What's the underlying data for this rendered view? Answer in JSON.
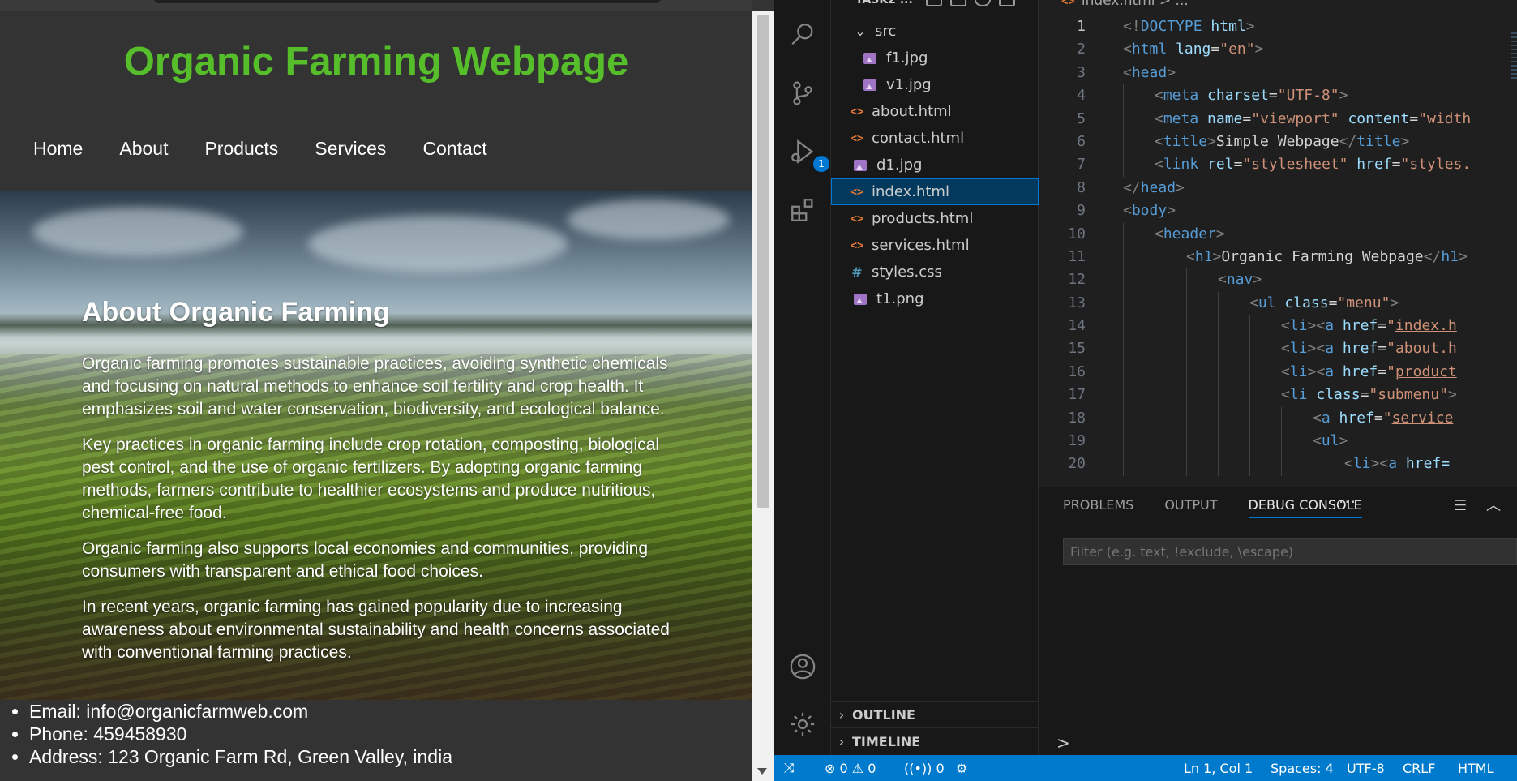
{
  "browser": {
    "site_title": "Organic Farming Webpage",
    "nav": [
      "Home",
      "About",
      "Products",
      "Services",
      "Contact"
    ],
    "about_title": "About Organic Farming",
    "paragraphs": [
      "Organic farming promotes sustainable practices, avoiding synthetic chemicals and focusing on natural methods to enhance soil fertility and crop health. It emphasizes soil and water conservation, biodiversity, and ecological balance.",
      "Key practices in organic farming include crop rotation, composting, biological pest control, and the use of organic fertilizers. By adopting organic farming methods, farmers contribute to healthier ecosystems and produce nutritious, chemical-free food.",
      "Organic farming also supports local economies and communities, providing consumers with transparent and ethical food choices.",
      "In recent years, organic farming has gained popularity due to increasing awareness about environmental sustainability and health concerns associated with conventional farming practices."
    ],
    "footer": {
      "email": "Email: info@organicfarmweb.com",
      "phone": "Phone: 459458930",
      "address": "Address: 123 Organic Farm Rd, Green Valley, india"
    }
  },
  "vscode": {
    "explorer": {
      "folder_title": "TASK2 ...",
      "items": [
        {
          "label": "src",
          "kind": "folder",
          "depth": 0
        },
        {
          "label": "f1.jpg",
          "kind": "image",
          "depth": 1
        },
        {
          "label": "v1.jpg",
          "kind": "image",
          "depth": 1
        },
        {
          "label": "about.html",
          "kind": "html",
          "depth": 0
        },
        {
          "label": "contact.html",
          "kind": "html",
          "depth": 0
        },
        {
          "label": "d1.jpg",
          "kind": "image",
          "depth": 0
        },
        {
          "label": "index.html",
          "kind": "html",
          "depth": 0,
          "selected": true
        },
        {
          "label": "products.html",
          "kind": "html",
          "depth": 0
        },
        {
          "label": "services.html",
          "kind": "html",
          "depth": 0
        },
        {
          "label": "styles.css",
          "kind": "css",
          "depth": 0
        },
        {
          "label": "t1.png",
          "kind": "image",
          "depth": 0
        }
      ],
      "outline_label": "OUTLINE",
      "timeline_label": "TIMELINE"
    },
    "debug_badge": "1",
    "breadcrumb": {
      "file": "index.html",
      "rest": "> ..."
    },
    "code_lines": [
      {
        "n": "1",
        "indent": 0,
        "tokens": [
          [
            "t-tag",
            "<!"
          ],
          [
            "t-name",
            "DOCTYPE"
          ],
          [
            "t-text",
            " "
          ],
          [
            "t-attr",
            "html"
          ],
          [
            "t-tag",
            ">"
          ]
        ]
      },
      {
        "n": "2",
        "indent": 0,
        "tokens": [
          [
            "t-tag",
            "<"
          ],
          [
            "t-name",
            "html"
          ],
          [
            "t-text",
            " "
          ],
          [
            "t-attr",
            "lang"
          ],
          [
            "t-text",
            "="
          ],
          [
            "t-str",
            "\"en\""
          ],
          [
            "t-tag",
            ">"
          ]
        ]
      },
      {
        "n": "3",
        "indent": 0,
        "tokens": [
          [
            "t-tag",
            "<"
          ],
          [
            "t-name",
            "head"
          ],
          [
            "t-tag",
            ">"
          ]
        ]
      },
      {
        "n": "4",
        "indent": 1,
        "tokens": [
          [
            "t-tag",
            "<"
          ],
          [
            "t-name",
            "meta"
          ],
          [
            "t-text",
            " "
          ],
          [
            "t-attr",
            "charset"
          ],
          [
            "t-text",
            "="
          ],
          [
            "t-str",
            "\"UTF-8\""
          ],
          [
            "t-tag",
            ">"
          ]
        ]
      },
      {
        "n": "5",
        "indent": 1,
        "tokens": [
          [
            "t-tag",
            "<"
          ],
          [
            "t-name",
            "meta"
          ],
          [
            "t-text",
            " "
          ],
          [
            "t-attr",
            "name"
          ],
          [
            "t-text",
            "="
          ],
          [
            "t-str",
            "\"viewport\""
          ],
          [
            "t-text",
            " "
          ],
          [
            "t-attr",
            "content"
          ],
          [
            "t-text",
            "="
          ],
          [
            "t-str",
            "\"width"
          ]
        ]
      },
      {
        "n": "6",
        "indent": 1,
        "tokens": [
          [
            "t-tag",
            "<"
          ],
          [
            "t-name",
            "title"
          ],
          [
            "t-tag",
            ">"
          ],
          [
            "t-text",
            "Simple Webpage"
          ],
          [
            "t-tag",
            "</"
          ],
          [
            "t-name",
            "title"
          ],
          [
            "t-tag",
            ">"
          ]
        ]
      },
      {
        "n": "7",
        "indent": 1,
        "tokens": [
          [
            "t-tag",
            "<"
          ],
          [
            "t-name",
            "link"
          ],
          [
            "t-text",
            " "
          ],
          [
            "t-attr",
            "rel"
          ],
          [
            "t-text",
            "="
          ],
          [
            "t-str",
            "\"stylesheet\""
          ],
          [
            "t-text",
            " "
          ],
          [
            "t-attr",
            "href"
          ],
          [
            "t-text",
            "="
          ],
          [
            "t-str",
            "\""
          ],
          [
            "t-link",
            "styles."
          ]
        ]
      },
      {
        "n": "8",
        "indent": 0,
        "tokens": [
          [
            "t-tag",
            "</"
          ],
          [
            "t-name",
            "head"
          ],
          [
            "t-tag",
            ">"
          ]
        ]
      },
      {
        "n": "9",
        "indent": 0,
        "tokens": [
          [
            "t-tag",
            "<"
          ],
          [
            "t-name",
            "body"
          ],
          [
            "t-tag",
            ">"
          ]
        ]
      },
      {
        "n": "10",
        "indent": 1,
        "tokens": [
          [
            "t-tag",
            "<"
          ],
          [
            "t-name",
            "header"
          ],
          [
            "t-tag",
            ">"
          ]
        ]
      },
      {
        "n": "11",
        "indent": 2,
        "tokens": [
          [
            "t-tag",
            "<"
          ],
          [
            "t-name",
            "h1"
          ],
          [
            "t-tag",
            ">"
          ],
          [
            "t-text",
            "Organic Farming Webpage"
          ],
          [
            "t-tag",
            "</"
          ],
          [
            "t-name",
            "h1"
          ],
          [
            "t-tag",
            ">"
          ]
        ]
      },
      {
        "n": "12",
        "indent": 3,
        "tokens": [
          [
            "t-tag",
            "<"
          ],
          [
            "t-name",
            "nav"
          ],
          [
            "t-tag",
            ">"
          ]
        ]
      },
      {
        "n": "13",
        "indent": 4,
        "tokens": [
          [
            "t-tag",
            "<"
          ],
          [
            "t-name",
            "ul"
          ],
          [
            "t-text",
            " "
          ],
          [
            "t-attr",
            "class"
          ],
          [
            "t-text",
            "="
          ],
          [
            "t-str",
            "\"menu\""
          ],
          [
            "t-tag",
            ">"
          ]
        ]
      },
      {
        "n": "14",
        "indent": 5,
        "tokens": [
          [
            "t-tag",
            "<"
          ],
          [
            "t-name",
            "li"
          ],
          [
            "t-tag",
            "><"
          ],
          [
            "t-name",
            "a"
          ],
          [
            "t-text",
            " "
          ],
          [
            "t-attr",
            "href"
          ],
          [
            "t-text",
            "="
          ],
          [
            "t-str",
            "\""
          ],
          [
            "t-link",
            "index.h"
          ]
        ]
      },
      {
        "n": "15",
        "indent": 5,
        "tokens": [
          [
            "t-tag",
            "<"
          ],
          [
            "t-name",
            "li"
          ],
          [
            "t-tag",
            "><"
          ],
          [
            "t-name",
            "a"
          ],
          [
            "t-text",
            " "
          ],
          [
            "t-attr",
            "href"
          ],
          [
            "t-text",
            "="
          ],
          [
            "t-str",
            "\""
          ],
          [
            "t-link",
            "about.h"
          ]
        ]
      },
      {
        "n": "16",
        "indent": 5,
        "tokens": [
          [
            "t-tag",
            "<"
          ],
          [
            "t-name",
            "li"
          ],
          [
            "t-tag",
            "><"
          ],
          [
            "t-name",
            "a"
          ],
          [
            "t-text",
            " "
          ],
          [
            "t-attr",
            "href"
          ],
          [
            "t-text",
            "="
          ],
          [
            "t-str",
            "\""
          ],
          [
            "t-link",
            "product"
          ]
        ]
      },
      {
        "n": "17",
        "indent": 5,
        "tokens": [
          [
            "t-tag",
            "<"
          ],
          [
            "t-name",
            "li"
          ],
          [
            "t-text",
            " "
          ],
          [
            "t-attr",
            "class"
          ],
          [
            "t-text",
            "="
          ],
          [
            "t-str",
            "\"submenu\""
          ],
          [
            "t-tag",
            ">"
          ]
        ]
      },
      {
        "n": "18",
        "indent": 6,
        "tokens": [
          [
            "t-tag",
            "<"
          ],
          [
            "t-name",
            "a"
          ],
          [
            "t-text",
            " "
          ],
          [
            "t-attr",
            "href"
          ],
          [
            "t-text",
            "="
          ],
          [
            "t-str",
            "\""
          ],
          [
            "t-link",
            "service"
          ]
        ]
      },
      {
        "n": "19",
        "indent": 6,
        "tokens": [
          [
            "t-tag",
            "<"
          ],
          [
            "t-name",
            "ul"
          ],
          [
            "t-tag",
            ">"
          ]
        ]
      },
      {
        "n": "20",
        "indent": 7,
        "tokens": [
          [
            "t-tag",
            "<"
          ],
          [
            "t-name",
            "li"
          ],
          [
            "t-tag",
            "><"
          ],
          [
            "t-name",
            "a"
          ],
          [
            "t-text",
            " "
          ],
          [
            "t-attr",
            "href="
          ]
        ]
      }
    ],
    "panel": {
      "tabs": [
        "PROBLEMS",
        "OUTPUT",
        "DEBUG CONSOLE"
      ],
      "active_tab": 2,
      "more": "···",
      "filter_placeholder": "Filter (e.g. text, !exclude, \\escape)",
      "prompt": ">"
    },
    "status_bar": {
      "remote": "⤨",
      "errors": "0",
      "warnings": "0",
      "ports": "0",
      "position": "Ln 1, Col 1",
      "spaces": "Spaces: 4",
      "encoding": "UTF-8",
      "eol": "CRLF",
      "language": "HTML"
    },
    "colors": {
      "accent": "#0078d4",
      "status_bar": "#007acc",
      "site_title": "#56bd2b"
    }
  }
}
